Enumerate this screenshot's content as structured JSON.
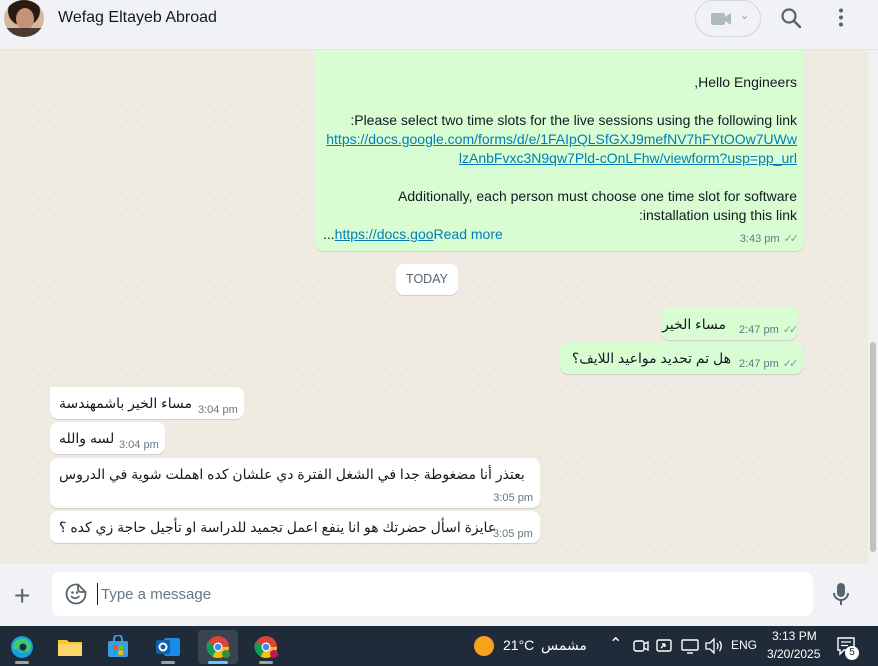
{
  "header": {
    "contact_name": "Wefag Eltayeb Abroad"
  },
  "messages": {
    "big": {
      "greeting": ",Hello Engineers",
      "line1": ":Please select two time slots for the live sessions using the following link",
      "link_part1": "https://docs.google.com/forms/d/e/1FAIpQLSfGXJ9mefNV7hFYtOOw7UWw",
      "link_part2": "lzAnbFvxc3N9qw7Pld-cOnLFhw/viewform?usp=pp_url",
      "line2": "Additionally, each person must choose one time slot for software",
      "line3": ":installation using this link",
      "truncated_prefix": "...",
      "truncated_link": "https://docs.goo",
      "read_more": "Read more",
      "time": "3:43 pm"
    },
    "date_divider": "TODAY",
    "out1": {
      "text": "مساء الخير",
      "time": "2:47 pm"
    },
    "out2": {
      "text": "هل تم تحديد مواعيد اللايف؟",
      "time": "2:47 pm"
    },
    "in1": {
      "text": "مساء الخير باشمهندسة",
      "time": "3:04 pm"
    },
    "in2": {
      "text": "لسه والله",
      "time": "3:04 pm"
    },
    "in3": {
      "text": "بعتذر أنا مضغوطة جدا في الشغل الفترة دي علشان كده اهملت شوية في الدروس",
      "time": "3:05 pm"
    },
    "in4": {
      "text": "عايزة اسأل حضرتك هو انا ينفع اعمل تجميد للدراسة او تأجيل حاجة زي كده ؟",
      "time": "3:05 pm"
    }
  },
  "composer": {
    "placeholder": "Type a message"
  },
  "taskbar": {
    "weather_temp": "21°C",
    "weather_label": "مشمس",
    "language": "ENG",
    "time": "3:13 PM",
    "date": "3/20/2025",
    "notification_count": "5"
  },
  "colors": {
    "outgoing_bubble": "#d9fdd3",
    "incoming_bubble": "#ffffff",
    "link": "#027eb5",
    "chat_bg": "#efeae2",
    "taskbar_bg": "#1f2b38"
  }
}
